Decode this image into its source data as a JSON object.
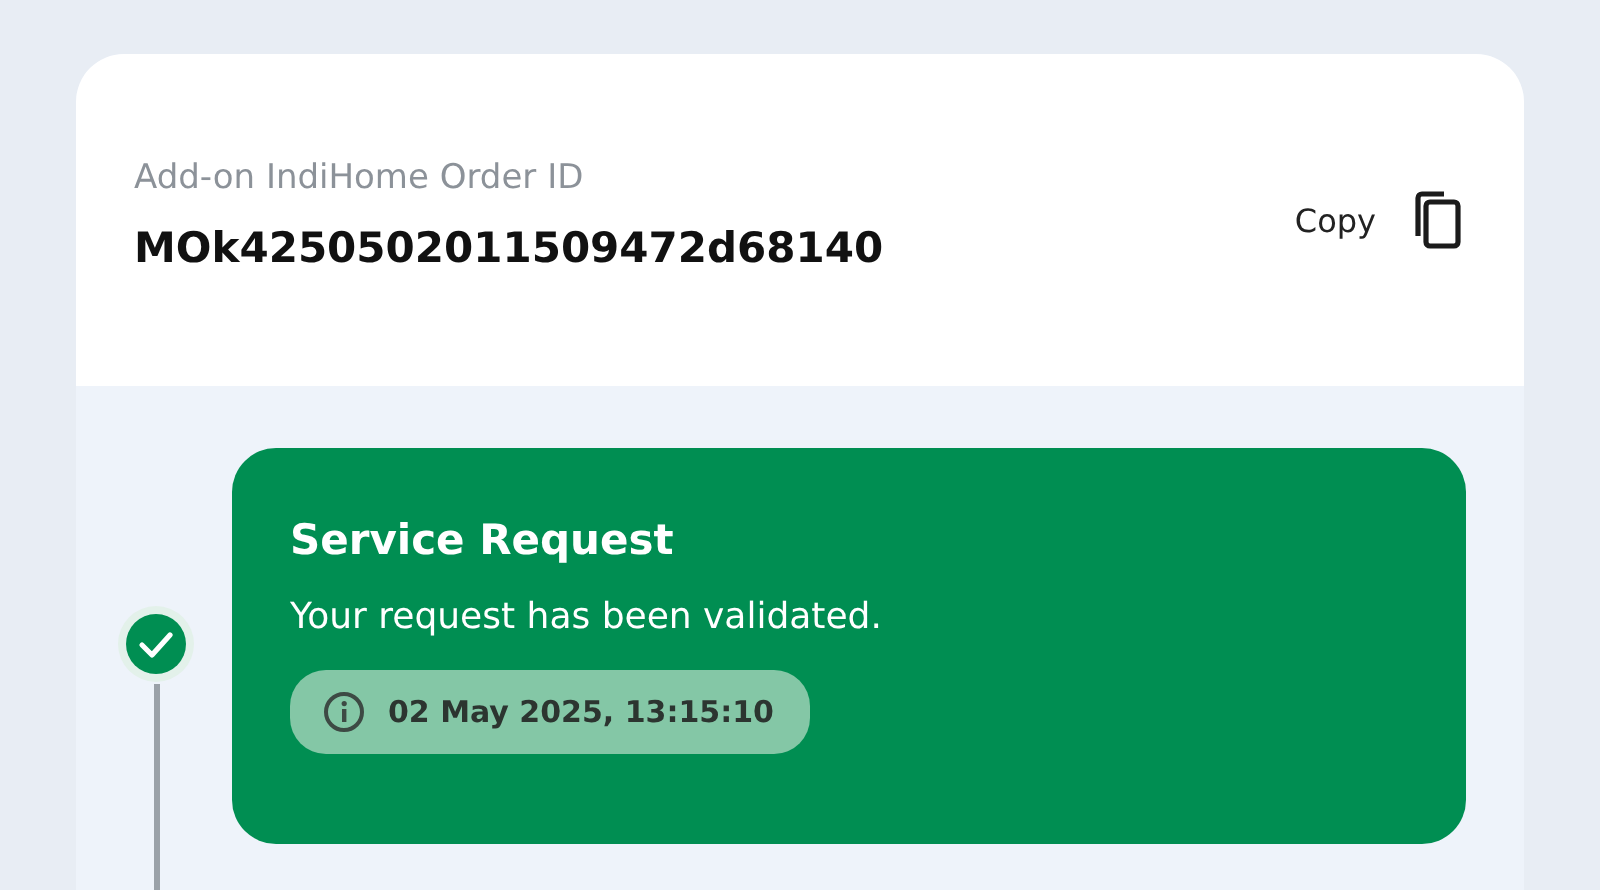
{
  "order": {
    "label": "Add-on IndiHome Order ID",
    "id": "MOk4250502011509472d68140",
    "copy_label": "Copy"
  },
  "steps": [
    {
      "title": "Service Request",
      "description": "Your request has been validated.",
      "time": "02 May 2025, 13:15:10",
      "completed": true
    }
  ]
}
